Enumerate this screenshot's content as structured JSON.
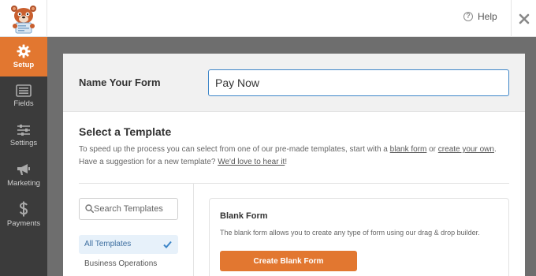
{
  "topbar": {
    "help_label": "Help",
    "help_icon": "help-circle-icon",
    "close_icon": "close-icon"
  },
  "sidebar": {
    "items": [
      {
        "label": "Setup",
        "icon": "gear-icon",
        "active": true
      },
      {
        "label": "Fields",
        "icon": "fields-list-icon",
        "active": false
      },
      {
        "label": "Settings",
        "icon": "sliders-icon",
        "active": false
      },
      {
        "label": "Marketing",
        "icon": "megaphone-icon",
        "active": false
      },
      {
        "label": "Payments",
        "icon": "dollar-icon",
        "active": false
      }
    ]
  },
  "form": {
    "name_label": "Name Your Form",
    "name_value": "Pay Now"
  },
  "templates": {
    "title": "Select a Template",
    "desc_1": "To speed up the process you can select from one of our pre-made templates, start with a ",
    "desc_link_1": "blank form",
    "desc_2": " or ",
    "desc_link_2": "create your own",
    "desc_3": ". Have a suggestion for a new template? ",
    "desc_link_3": "We'd love to hear it",
    "desc_4": "!",
    "search_placeholder": "Search Templates",
    "categories": [
      {
        "label": "All Templates",
        "active": true
      },
      {
        "label": "Business Operations",
        "active": false
      }
    ],
    "card": {
      "title": "Blank Form",
      "desc": "The blank form allows you to create any type of form using our drag & drop builder.",
      "button": "Create Blank Form"
    }
  },
  "colors": {
    "accent": "#e27730",
    "sidebar_bg": "#3b3b3b",
    "input_focus": "#3e86c8"
  }
}
